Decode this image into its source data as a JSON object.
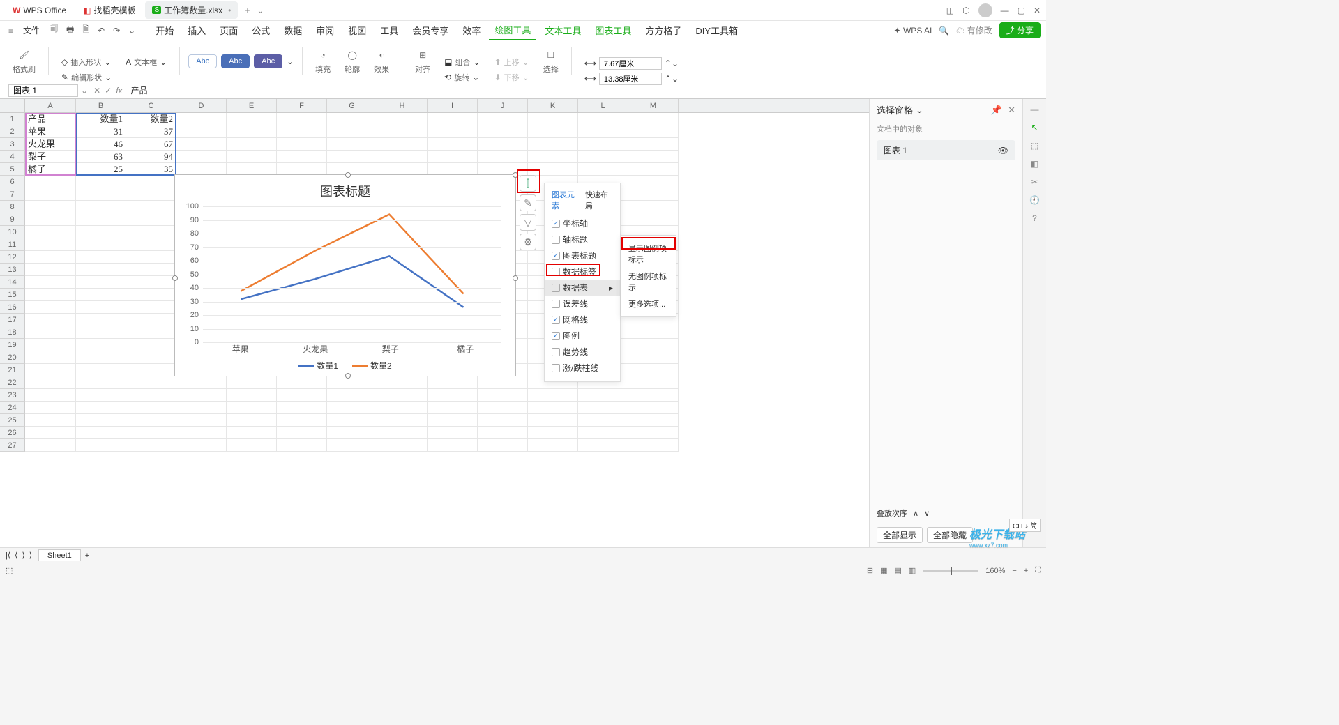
{
  "titlebar": {
    "app": "WPS Office",
    "tab2": "找稻壳模板",
    "tab3": "工作簿数量.xlsx"
  },
  "menu": {
    "file": "文件",
    "items": [
      "开始",
      "插入",
      "页面",
      "公式",
      "数据",
      "审阅",
      "视图",
      "工具",
      "会员专享",
      "效率",
      "绘图工具",
      "文本工具",
      "图表工具",
      "方方格子",
      "DIY工具箱"
    ],
    "wpsai": "WPS AI",
    "cloud": "有修改",
    "share": "分享"
  },
  "ribbon": {
    "format_painter": "格式刷",
    "insert_shape": "插入形状",
    "textbox": "文本框",
    "edit_shape": "编辑形状",
    "abc": "Abc",
    "fill": "填充",
    "outline": "轮廓",
    "effect": "效果",
    "align": "对齐",
    "group": "组合",
    "rotate": "旋转",
    "up": "上移",
    "down": "下移",
    "select": "选择",
    "height": "7.67厘米",
    "width": "13.38厘米"
  },
  "namebox": "图表 1",
  "formula": "产品",
  "cols": [
    "A",
    "B",
    "C",
    "D",
    "E",
    "F",
    "G",
    "H",
    "I",
    "J",
    "K",
    "L",
    "M"
  ],
  "table": {
    "headers": [
      "产品",
      "数量1",
      "数量2"
    ],
    "rows": [
      [
        "苹果",
        "31",
        "37"
      ],
      [
        "火龙果",
        "46",
        "67"
      ],
      [
        "梨子",
        "63",
        "94"
      ],
      [
        "橘子",
        "25",
        "35"
      ]
    ]
  },
  "chart_data": {
    "type": "line",
    "title": "图表标题",
    "categories": [
      "苹果",
      "火龙果",
      "梨子",
      "橘子"
    ],
    "series": [
      {
        "name": "数量1",
        "values": [
          31,
          46,
          63,
          25
        ],
        "color": "#4472c4"
      },
      {
        "name": "数量2",
        "values": [
          37,
          67,
          94,
          35
        ],
        "color": "#ed7d31"
      }
    ],
    "ylim": [
      0,
      100
    ],
    "yticks": [
      0,
      10,
      20,
      30,
      40,
      50,
      60,
      70,
      80,
      90,
      100
    ]
  },
  "popup": {
    "tab1": "图表元素",
    "tab2": "快速布局",
    "items": [
      {
        "label": "坐标轴",
        "checked": true
      },
      {
        "label": "轴标题",
        "checked": false
      },
      {
        "label": "图表标题",
        "checked": true
      },
      {
        "label": "数据标签",
        "checked": false
      },
      {
        "label": "数据表",
        "checked": false,
        "hover": true
      },
      {
        "label": "误差线",
        "checked": false
      },
      {
        "label": "网格线",
        "checked": true
      },
      {
        "label": "图例",
        "checked": true
      },
      {
        "label": "趋势线",
        "checked": false
      },
      {
        "label": "涨/跌柱线",
        "checked": false
      }
    ]
  },
  "subpopup": {
    "item1": "显示图例项标示",
    "item2": "无图例项标示",
    "item3": "更多选项..."
  },
  "side": {
    "title": "选择窗格",
    "sub": "文档中的对象",
    "obj": "图表 1",
    "stack": "叠放次序",
    "show_all": "全部显示",
    "hide_all": "全部隐藏"
  },
  "sheet": "Sheet1",
  "status": {
    "zoom": "160%"
  },
  "watermark": {
    "main": "极光下载站",
    "sub": "www.xz7.com"
  },
  "ime": "CH ♪ 简"
}
